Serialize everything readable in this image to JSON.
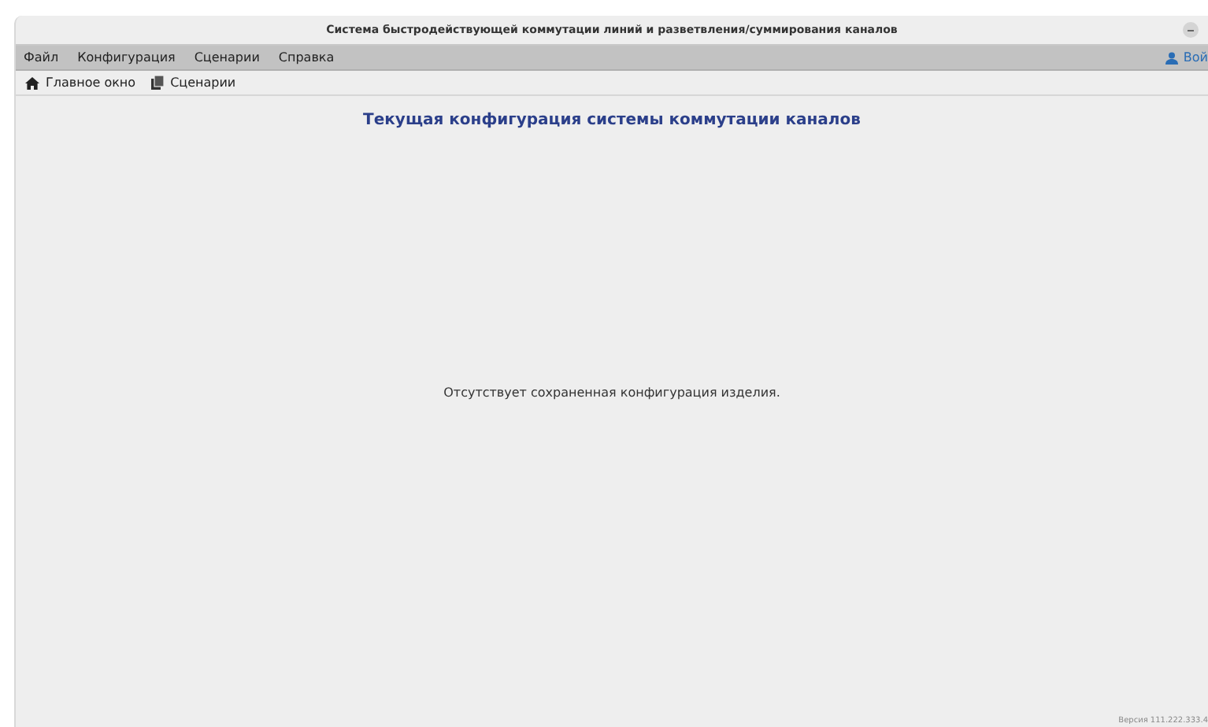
{
  "window": {
    "title": "Система быстродействующей коммутации линий и разветвления/суммирования каналов"
  },
  "menu": {
    "items": [
      "Файл",
      "Конфигурация",
      "Сценарии",
      "Справка"
    ],
    "login": "Вой"
  },
  "toolbar": {
    "items": [
      {
        "label": "Главное окно",
        "kind": "home"
      },
      {
        "label": "Сценарии",
        "kind": "scenarios"
      }
    ]
  },
  "content": {
    "heading": "Текущая конфигурация системы коммутации каналов",
    "message": "Отсутствует сохраненная конфигурация изделия."
  },
  "status_bar": {
    "version": "Версия 111.222.333.4"
  }
}
